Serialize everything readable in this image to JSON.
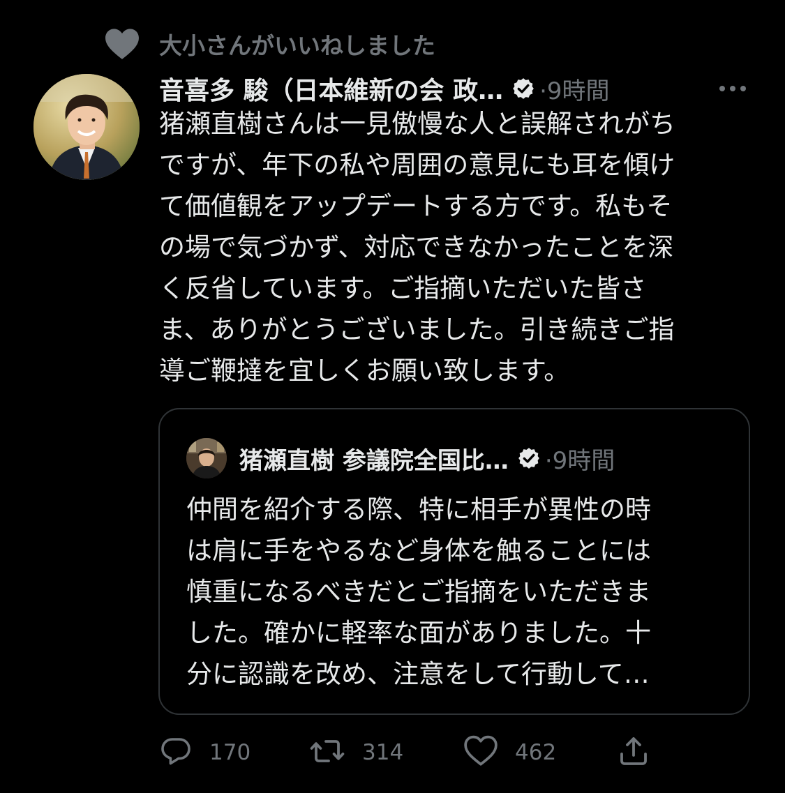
{
  "social_context": {
    "text": "大小さんがいいねしました",
    "icon": "heart-icon"
  },
  "tweet": {
    "display_name": "音喜多 駿（日本維新の会 政…",
    "verified": true,
    "separator": "·",
    "time": "9時間",
    "more_icon": "more-icon",
    "text_lines": [
      "猪瀬直樹さんは一見傲慢な人と誤解されがち",
      "ですが、年下の私や周囲の意見にも耳を傾け",
      "て価値観をアップデートする方です。私もそ",
      "の場で気づかず、対応できなかったことを深",
      "く反省しています。ご指摘いただいた皆さ",
      "ま、ありがとうございました。引き続きご指",
      "導ご鞭撻を宜しくお願い致します。"
    ]
  },
  "quote": {
    "display_name": "猪瀬直樹 参議院全国比…",
    "verified": true,
    "separator": "·",
    "time": "9時間",
    "text_lines": [
      "仲間を紹介する際、特に相手が異性の時",
      "は肩に手をやるなど身体を触ることには",
      "慎重になるべきだとご指摘をいただきま",
      "した。確かに軽率な面がありました。十",
      "分に認識を改め、注意をして行動して…"
    ]
  },
  "actions": {
    "replies": "170",
    "retweets": "314",
    "likes": "462",
    "icons": [
      "reply-icon",
      "retweet-icon",
      "like-icon",
      "share-icon"
    ]
  },
  "colors": {
    "background": "#000000",
    "text": "#e7e9ea",
    "secondary": "#71767b",
    "border": "#2f3336"
  }
}
